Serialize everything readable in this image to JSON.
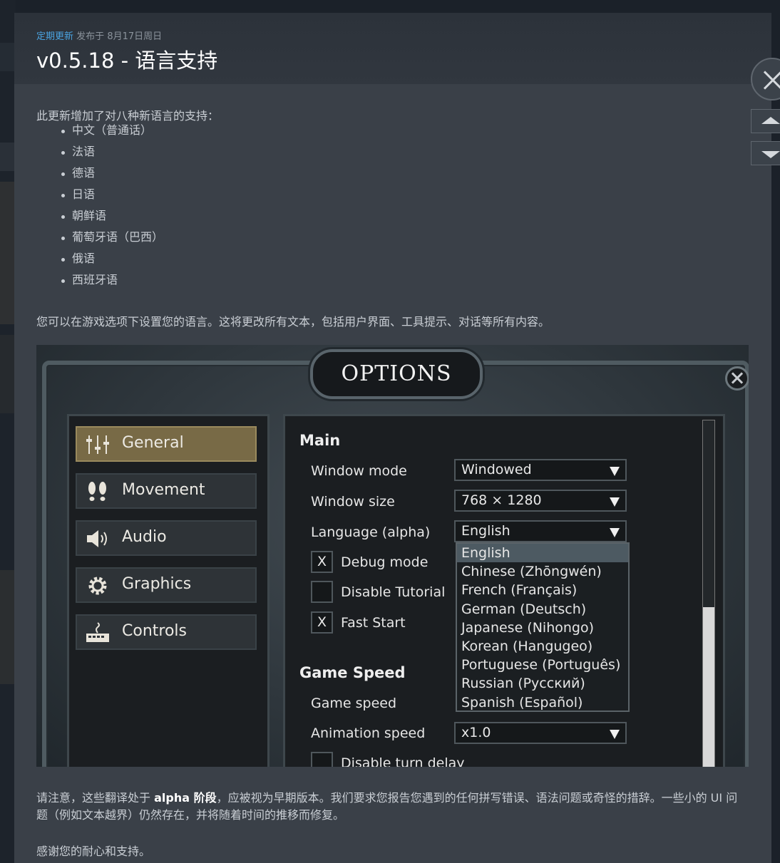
{
  "post": {
    "category": "定期更新",
    "published_prefix": "发布于",
    "date": "8月17日周日",
    "title": "v0.5.18 - 语言支持"
  },
  "body": {
    "intro": "此更新增加了对八种新语言的支持：",
    "languages": [
      "中文（普通话）",
      "法语",
      "德语",
      "日语",
      "朝鲜语",
      "葡萄牙语（巴西）",
      "俄语",
      "西班牙语"
    ],
    "para1": "您可以在游戏选项下设置您的语言。这将更改所有文本，包括用户界面、工具提示、对话等所有内容。",
    "para2_before": "请注意，这些翻译处于 ",
    "para2_bold": "alpha 阶段",
    "para2_after": "，应被视为早期版本。我们要求您报告您遇到的任何拼写错误、语法问题或奇怪的措辞。一些小的 UI 问题（例如文本越界）仍然存在，并将随着时间的推移而修复。",
    "para3": "感谢您的耐心和支持。"
  },
  "game_screenshot": {
    "banner": "OPTIONS",
    "sidebar": [
      {
        "label": "General",
        "icon": "sliders-icon",
        "active": true
      },
      {
        "label": "Movement",
        "icon": "footprints-icon",
        "active": false
      },
      {
        "label": "Audio",
        "icon": "speaker-icon",
        "active": false
      },
      {
        "label": "Graphics",
        "icon": "gear-icon",
        "active": false
      },
      {
        "label": "Controls",
        "icon": "keyboard-icon",
        "active": false
      }
    ],
    "main_title": "Main",
    "window_mode_label": "Window mode",
    "window_mode_value": "Windowed",
    "window_size_label": "Window size",
    "window_size_value": "768 × 1280",
    "language_label": "Language (alpha)",
    "language_value": "English",
    "debug_label": "Debug mode",
    "debug_mark": "X",
    "tutorial_label": "Disable Tutorial",
    "tutorial_mark": "",
    "fast_start_label": "Fast Start",
    "fast_start_mark": "X",
    "game_speed_title": "Game Speed",
    "game_speed_label": "Game speed",
    "anim_speed_label": "Animation speed",
    "anim_speed_value": "x1.0",
    "turn_delay_label": "Disable turn delay",
    "language_options": [
      "English",
      "Chinese (Zhōngwén)",
      "French (Français)",
      "German (Deutsch)",
      "Japanese (Nihongo)",
      "Korean (Hangugeo)",
      "Portuguese (Português)",
      "Russian (Русский)",
      "Spanish (Español)"
    ],
    "language_selected_index": 0
  },
  "colors": {
    "accent": "#4aa3e0",
    "modal_bg": "#3a4048",
    "header_bg": "#2c323a",
    "active_tab": "#786a46"
  }
}
